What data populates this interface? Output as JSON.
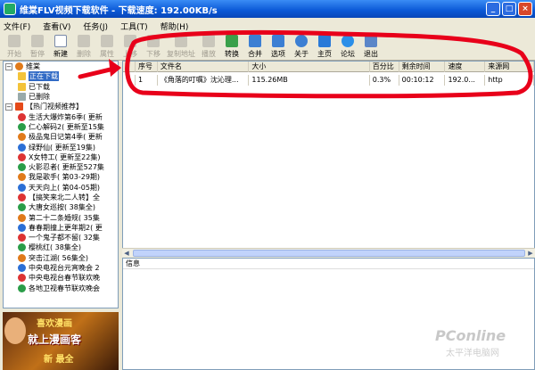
{
  "window": {
    "title": "维棠FLV视频下载软件 - 下载速度: 192.00KB/s",
    "buttons": [
      "_",
      "□",
      "×"
    ]
  },
  "menu": [
    "文件(F)",
    "查看(V)",
    "任务(J)",
    "工具(T)",
    "帮助(H)"
  ],
  "toolbar": [
    {
      "label": "开始",
      "enabled": false
    },
    {
      "label": "暂停",
      "enabled": false
    },
    {
      "label": "新建",
      "enabled": true,
      "icon": "new-file-icon"
    },
    {
      "label": "删除",
      "enabled": false
    },
    {
      "label": "属性",
      "enabled": false
    },
    {
      "label": "上移",
      "enabled": false
    },
    {
      "label": "下移",
      "enabled": false
    },
    {
      "label": "复制地址",
      "enabled": false
    },
    {
      "label": "播放",
      "enabled": false
    },
    {
      "label": "转换",
      "enabled": true
    },
    {
      "label": "合并",
      "enabled": true
    },
    {
      "label": "选项",
      "enabled": true
    },
    {
      "label": "关于",
      "enabled": true
    },
    {
      "label": "主页",
      "enabled": true
    },
    {
      "label": "论坛",
      "enabled": true
    },
    {
      "label": "退出",
      "enabled": true
    }
  ],
  "tree": {
    "root": "维棠",
    "items": [
      "正在下载",
      "已下载",
      "已删除"
    ],
    "hot_header": "【热门视频推荐】",
    "hot": [
      "生活大爆炸第6季( 更新",
      "仁心解码2( 更新至15集",
      "极品鬼日记第4季( 更新",
      "绿野仙( 更新至19集)",
      "X女特工( 更新至22集)",
      "火影忍者( 更新至527集",
      "我是歌手( 第03-29期)",
      "天天向上( 第04-05期)",
      "【搞笑来北二人转】全",
      "大唐女巡按( 38集全)",
      "第二十二条婚规( 35集",
      "春春期撞上更年期2( 更",
      "一个鬼子都不留( 32集",
      "樱桃红( 38集全)",
      "突击江湖( 56集全)",
      "中央电视台元宵晚会 2",
      "中央电视台春节联欢晚",
      "各地卫视春节联欢晚会"
    ]
  },
  "table": {
    "headers": [
      "序号",
      "文件名",
      "大小",
      "百分比",
      "剩余时间",
      "速度",
      "来源网"
    ],
    "rows": [
      [
        "1",
        "《角落的叮嘱》沈沁理...",
        "115.26MB",
        "0.3%",
        "00:10:12",
        "192.0...",
        "http"
      ]
    ]
  },
  "info_title": "信息",
  "ad": {
    "line1": "喜欢漫画",
    "line2": "就上漫画客",
    "line3": "新 最全"
  },
  "watermark": {
    "brand": "PConline",
    "sub": "太平洋电脑网"
  },
  "colors": {
    "accent": "#316ac5",
    "title_bar": "#0a58d6",
    "annotation": "#e8001a"
  }
}
